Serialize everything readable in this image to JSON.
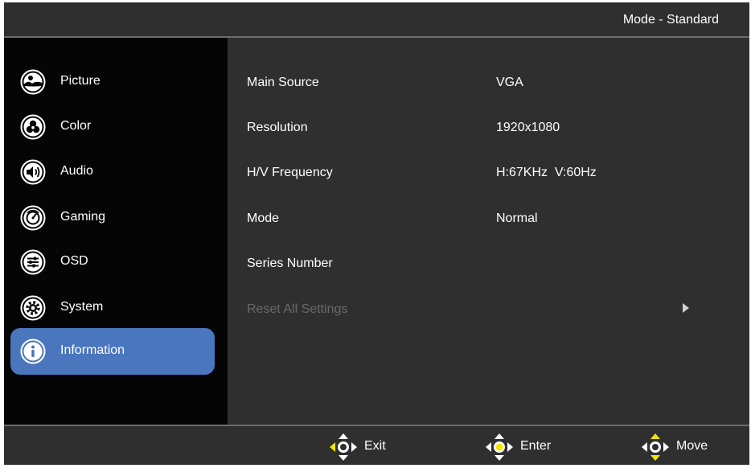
{
  "header": {
    "mode_label": "Mode - Standard"
  },
  "sidebar": {
    "items": [
      {
        "label": "Picture",
        "icon": "picture-icon",
        "active": false
      },
      {
        "label": "Color",
        "icon": "color-icon",
        "active": false
      },
      {
        "label": "Audio",
        "icon": "audio-icon",
        "active": false
      },
      {
        "label": "Gaming",
        "icon": "gaming-icon",
        "active": false
      },
      {
        "label": "OSD",
        "icon": "osd-icon",
        "active": false
      },
      {
        "label": "System",
        "icon": "system-icon",
        "active": false
      },
      {
        "label": "Information",
        "icon": "info-icon",
        "active": true
      }
    ]
  },
  "info": {
    "rows": [
      {
        "label": "Main Source",
        "value": "VGA"
      },
      {
        "label": "Resolution",
        "value": "1920x1080"
      },
      {
        "label": "H/V Frequency",
        "value": "H:67KHz  V:60Hz"
      },
      {
        "label": "Mode",
        "value": "Normal"
      },
      {
        "label": "Series Number",
        "value": ""
      },
      {
        "label": "Reset All Settings",
        "value": "",
        "disabled": true
      }
    ]
  },
  "footer": {
    "hints": [
      {
        "label": "Exit",
        "icon": "joystick-left-icon"
      },
      {
        "label": "Enter",
        "icon": "joystick-press-icon"
      },
      {
        "label": "Move",
        "icon": "joystick-updown-icon"
      }
    ]
  },
  "colors": {
    "accent": "#4a76be",
    "highlight": "#f2e600",
    "panel": "#2f2f2f",
    "sidebar": "#050505",
    "disabled_text": "#6a6a6a"
  }
}
